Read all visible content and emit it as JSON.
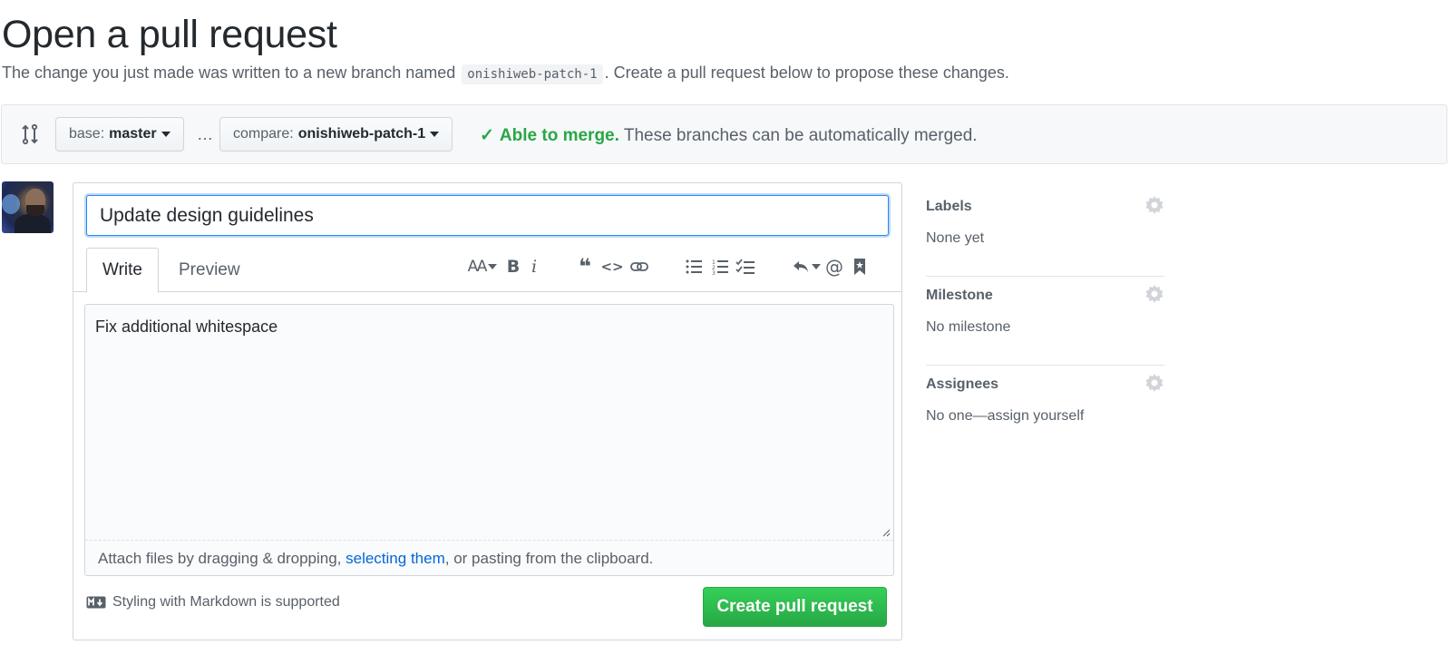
{
  "page": {
    "title": "Open a pull request",
    "intro_before": "The change you just made was written to a new branch named ",
    "branch_name": "onishiweb-patch-1",
    "intro_after": ". Create a pull request below to propose these changes."
  },
  "range": {
    "base_prefix": "base:",
    "base_branch": "master",
    "separator": "…",
    "compare_prefix": "compare:",
    "compare_branch": "onishiweb-patch-1",
    "merge_status": "Able to merge.",
    "merge_detail": " These branches can be automatically merged."
  },
  "form": {
    "title_value": "Update design guidelines",
    "tabs": [
      {
        "label": "Write",
        "active": true
      },
      {
        "label": "Preview",
        "active": false
      }
    ],
    "toolbar": {
      "header": "AA",
      "bold": "B",
      "italic": "i",
      "quote": "❝",
      "code": "<>",
      "link": "∞",
      "ul": "☰",
      "ol": "≡",
      "tasks": "✓",
      "reply": "↶",
      "mention": "@",
      "bookmark": "▮"
    },
    "body": "Fix additional whitespace",
    "attach_before": "Attach files by dragging & dropping, ",
    "attach_link": "selecting them",
    "attach_after": ", or pasting from the clipboard.",
    "markdown_note": "Styling with Markdown is supported",
    "submit_label": "Create pull request"
  },
  "sidebar": {
    "sections": [
      {
        "heading": "Labels",
        "value": "None yet"
      },
      {
        "heading": "Milestone",
        "value": "No milestone"
      },
      {
        "heading": "Assignees",
        "value": "No one—assign yourself"
      }
    ]
  },
  "colors": {
    "accent_blue": "#0366d6",
    "success_green": "#28a745",
    "text": "#24292e",
    "muted": "#586069"
  }
}
